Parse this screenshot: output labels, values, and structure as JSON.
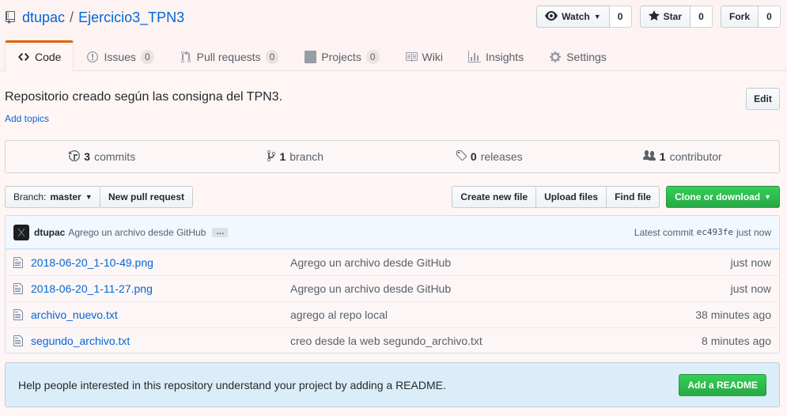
{
  "repo": {
    "owner": "dtupac",
    "separator": "/",
    "name": "Ejercicio3_TPN3"
  },
  "actions": {
    "watch": {
      "label": "Watch",
      "count": "0"
    },
    "star": {
      "label": "Star",
      "count": "0"
    },
    "fork": {
      "label": "Fork",
      "count": "0"
    }
  },
  "nav": {
    "code": "Code",
    "issues": {
      "label": "Issues",
      "count": "0"
    },
    "pulls": {
      "label": "Pull requests",
      "count": "0"
    },
    "projects": {
      "label": "Projects",
      "count": "0"
    },
    "wiki": "Wiki",
    "insights": "Insights",
    "settings": "Settings"
  },
  "description": "Repositorio creado según las consigna del TPN3.",
  "add_topics": "Add topics",
  "edit_label": "Edit",
  "summary": {
    "commits": {
      "num": "3",
      "label": "commits"
    },
    "branch": {
      "num": "1",
      "label": "branch"
    },
    "releases": {
      "num": "0",
      "label": "releases"
    },
    "contributor": {
      "num": "1",
      "label": "contributor"
    }
  },
  "toolbar": {
    "branch_prefix": "Branch:",
    "branch_name": "master",
    "new_pr": "New pull request",
    "create_file": "Create new file",
    "upload_files": "Upload files",
    "find_file": "Find file",
    "clone": "Clone or download"
  },
  "latest_commit": {
    "author": "dtupac",
    "message": "Agrego un archivo desde GitHub",
    "ellipsis": "…",
    "label": "Latest commit",
    "sha": "ec493fe",
    "age": "just now"
  },
  "files": [
    {
      "name": "2018-06-20_1-10-49.png",
      "message": "Agrego un archivo desde GitHub",
      "age": "just now"
    },
    {
      "name": "2018-06-20_1-11-27.png",
      "message": "Agrego un archivo desde GitHub",
      "age": "just now"
    },
    {
      "name": "archivo_nuevo.txt",
      "message": "agrego al repo local",
      "age": "38 minutes ago"
    },
    {
      "name": "segundo_archivo.txt",
      "message": "creo desde la web segundo_archivo.txt",
      "age": "8 minutes ago"
    }
  ],
  "readme_banner": {
    "text": "Help people interested in this repository understand your project by adding a README.",
    "button": "Add a README"
  },
  "colors": {
    "accent_tab": "#e36209",
    "link": "#0366d6",
    "green_button": "#28a745",
    "banner_bg": "#dbedf8"
  }
}
